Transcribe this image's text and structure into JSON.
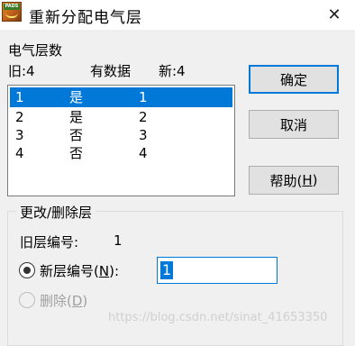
{
  "window": {
    "title": "重新分配电气层",
    "close_glyph": "✕",
    "app_icon_badge": "PADS"
  },
  "info": {
    "count_label": "电气层数",
    "old_label": "旧:4",
    "has_data_label": "有数据",
    "new_label": "新:4"
  },
  "layer_list": {
    "rows": [
      {
        "num": "1",
        "has_data": "是",
        "new": "1",
        "selected": true
      },
      {
        "num": "2",
        "has_data": "是",
        "new": "2",
        "selected": false
      },
      {
        "num": "3",
        "has_data": "否",
        "new": "3",
        "selected": false
      },
      {
        "num": "4",
        "has_data": "否",
        "new": "4",
        "selected": false
      }
    ]
  },
  "buttons": {
    "ok": "确定",
    "cancel": "取消",
    "help_prefix": "帮助(",
    "help_key": "H",
    "help_suffix": ")"
  },
  "modify_group": {
    "title": "更改/删除层",
    "old_num_label": "旧层编号:",
    "old_num_value": "1",
    "new_num_prefix": "新层编号(",
    "new_num_key": "N",
    "new_num_suffix": "):",
    "new_num_value": "1",
    "delete_prefix": "删除(",
    "delete_key": "D",
    "delete_suffix": ")"
  },
  "watermark": "https://blog.csdn.net/sinat_41653350",
  "colors": {
    "accent": "#0078d7",
    "dialog_bg": "#f0f0f0",
    "disabled": "#a0a0a0"
  }
}
